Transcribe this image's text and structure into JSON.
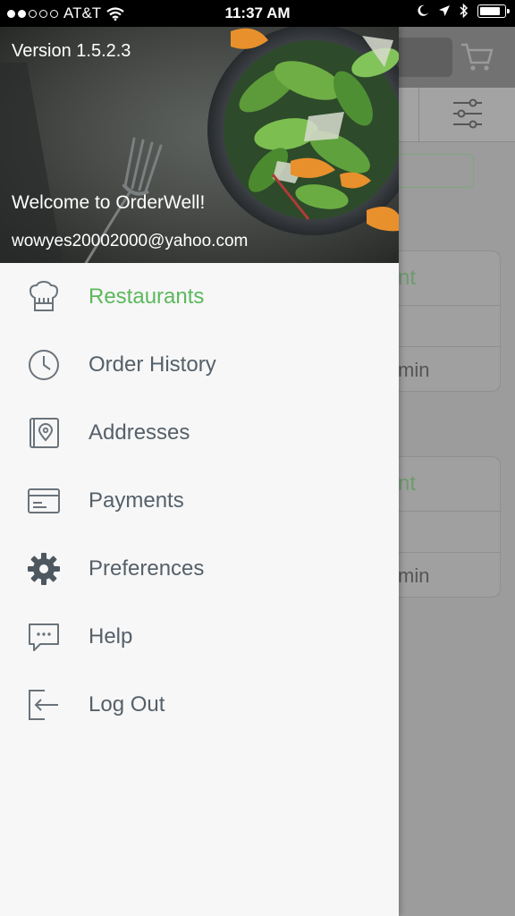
{
  "status_bar": {
    "carrier": "AT&T",
    "time": "11:37 AM",
    "signal_filled": 2,
    "signal_total": 5,
    "battery_level": 0.85
  },
  "drawer": {
    "version": "Version 1.5.2.3",
    "welcome": "Welcome to OrderWell!",
    "email": "wowyes20002000@yahoo.com",
    "accent_color": "#5cb85c",
    "items": [
      {
        "label": "Restaurants",
        "icon": "chef-hat-icon",
        "active": true
      },
      {
        "label": "Order History",
        "icon": "clock-icon",
        "active": false
      },
      {
        "label": "Addresses",
        "icon": "address-book-icon",
        "active": false
      },
      {
        "label": "Payments",
        "icon": "credit-card-icon",
        "active": false
      },
      {
        "label": "Preferences",
        "icon": "gear-icon",
        "active": false
      },
      {
        "label": "Help",
        "icon": "chat-bubble-icon",
        "active": false
      },
      {
        "label": "Log Out",
        "icon": "logout-icon",
        "active": false
      }
    ]
  },
  "background": {
    "cards": [
      {
        "category_fragment": "nt",
        "time_fragment": "min"
      },
      {
        "category_fragment": "nt",
        "time_fragment": "min"
      }
    ]
  }
}
